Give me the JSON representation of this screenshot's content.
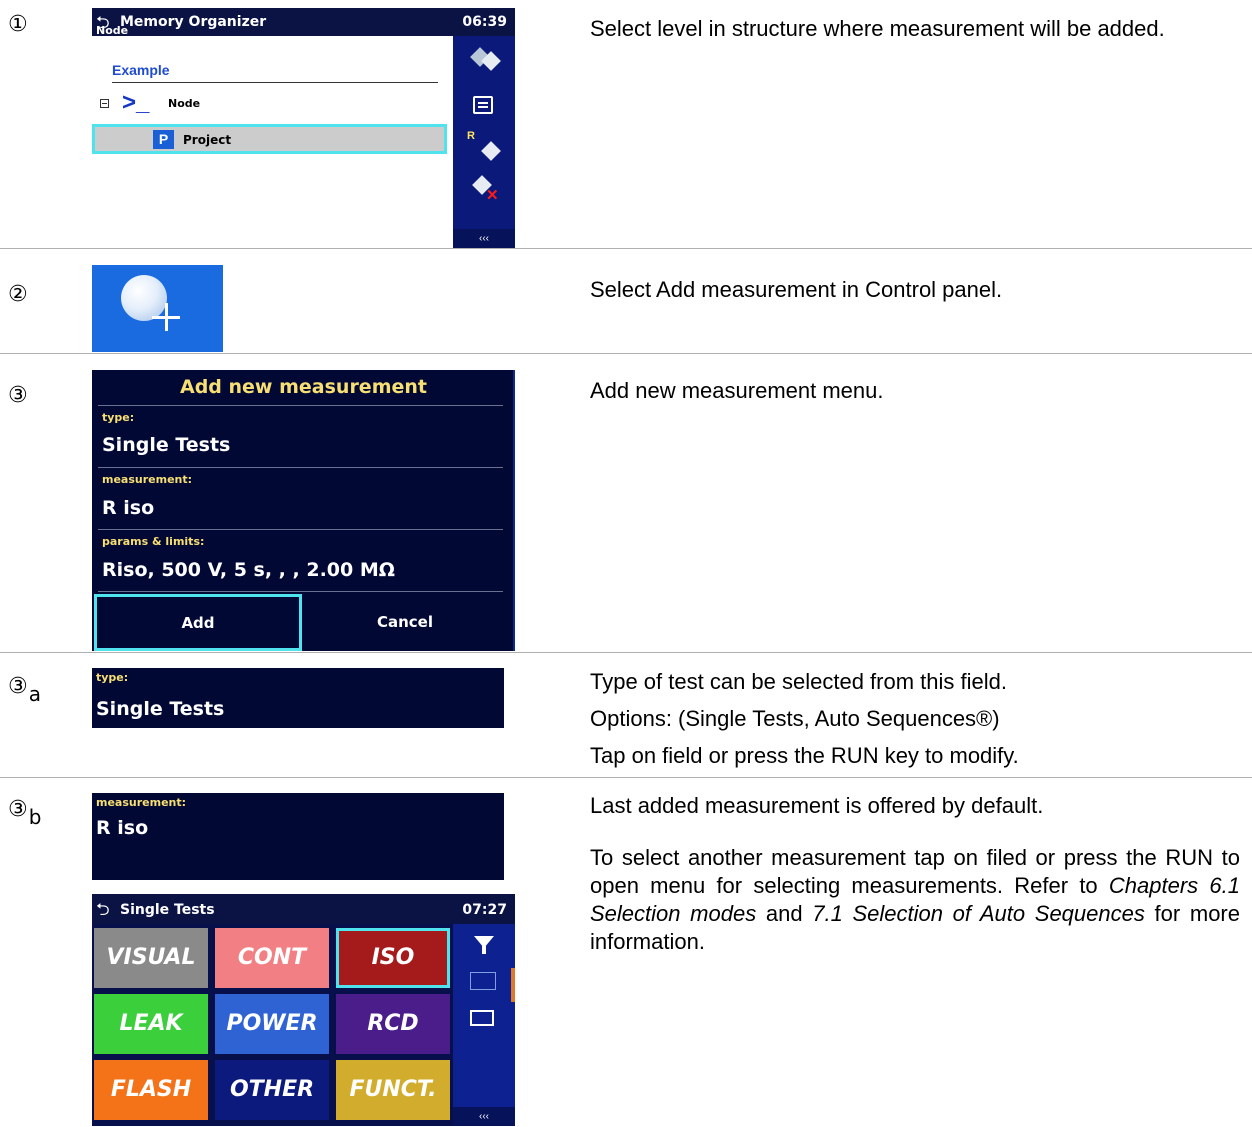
{
  "steps": {
    "s1": "①",
    "s2": "②",
    "s3": "③",
    "s3a_num": "③",
    "s3a_sub": "a",
    "s3b_num": "③",
    "s3b_sub": "b"
  },
  "descriptions": {
    "s1": "Select level in structure where measurement will be added.",
    "s2": "Select Add measurement in Control panel.",
    "s3": "Add new measurement menu.",
    "s3a_1": "Type of test can be selected from this field.",
    "s3a_2": "Options: (Single Tests, Auto Sequences®)",
    "s3a_3": "Tap on field or press the RUN key to modify.",
    "s3b_1": "Last added measurement is offered by default.",
    "s3b_2a": "To select another measurement tap on filed or press the RUN to open menu for selecting measurements. Refer to ",
    "s3b_2b": "Chapters 6.1 Selection modes",
    "s3b_2c": " and ",
    "s3b_2d": "7.1 Selection of Auto Sequences",
    "s3b_2e": " for more information."
  },
  "memory_organizer": {
    "title": "Memory Organizer",
    "time": "06:39",
    "node_label": "Node",
    "example": "Example",
    "node_item": "Node",
    "project_item": "Project",
    "more": "‹‹‹"
  },
  "add_measurement_screen": {
    "header": "Add new measurement",
    "type_label": "type:",
    "type_value": "Single Tests",
    "measurement_label": "measurement:",
    "measurement_value": "R iso",
    "params_label": "params & limits:",
    "params_value": "Riso, 500 V, 5 s, , , 2.00 MΩ",
    "add_label": "Add",
    "cancel_label": "Cancel"
  },
  "field_type": {
    "label": "type:",
    "value": "Single Tests"
  },
  "field_measurement": {
    "label": "measurement:",
    "value": "R iso"
  },
  "single_tests": {
    "title": "Single Tests",
    "time": "07:27",
    "more": "‹‹‹",
    "cells": [
      "VISUAL",
      "CONT",
      "ISO",
      "LEAK",
      "POWER",
      "RCD",
      "FLASH",
      "OTHER",
      "FUNCT."
    ]
  },
  "colors": {
    "cell_visual": "#8a8a8a",
    "cell_cont": "#f27f84",
    "cell_iso": "#a51b1b",
    "cell_leak": "#3ccf3c",
    "cell_power": "#2f63d4",
    "cell_rcd": "#4a1d8a",
    "cell_flash": "#f47318",
    "cell_other": "#0c1a7e",
    "cell_funct": "#d2ad2d"
  },
  "icons": [
    "back-arrow-icon",
    "cube-icon",
    "list-icon",
    "r-cube-icon",
    "delete-cube-icon",
    "add-measurement-icon",
    "filter-icon",
    "grid-view-icon",
    "swap-icon"
  ]
}
